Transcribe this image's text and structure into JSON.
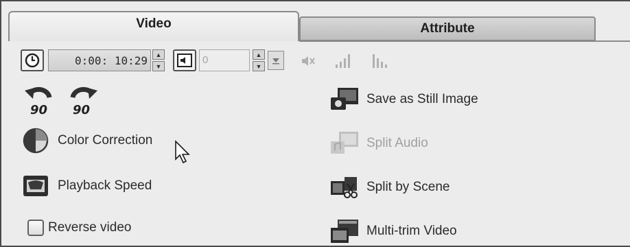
{
  "tabs": {
    "video_label": "Video",
    "attribute_label": "Attribute"
  },
  "toolbar": {
    "time_value": "0:00: 10:29",
    "volume_value": "0",
    "icons": [
      "clock-icon",
      "speaker-icon",
      "mute-icon",
      "fade-in-icon",
      "fade-out-icon",
      "dropdown-arrow-icon"
    ]
  },
  "rotate": {
    "left_label": "90",
    "right_label": "90"
  },
  "left_actions": {
    "color_correction": "Color Correction",
    "playback_speed": "Playback Speed",
    "reverse_video": "Reverse video"
  },
  "right_actions": {
    "save_still": "Save as Still Image",
    "split_audio": "Split Audio",
    "split_scene": "Split by Scene",
    "multi_trim": "Multi-trim Video"
  },
  "colors": {
    "panel_bg": "#ececec",
    "tab_active": "#efefef",
    "tab_inactive": "#c8c8c8",
    "disabled_text": "#a0a0a0"
  }
}
